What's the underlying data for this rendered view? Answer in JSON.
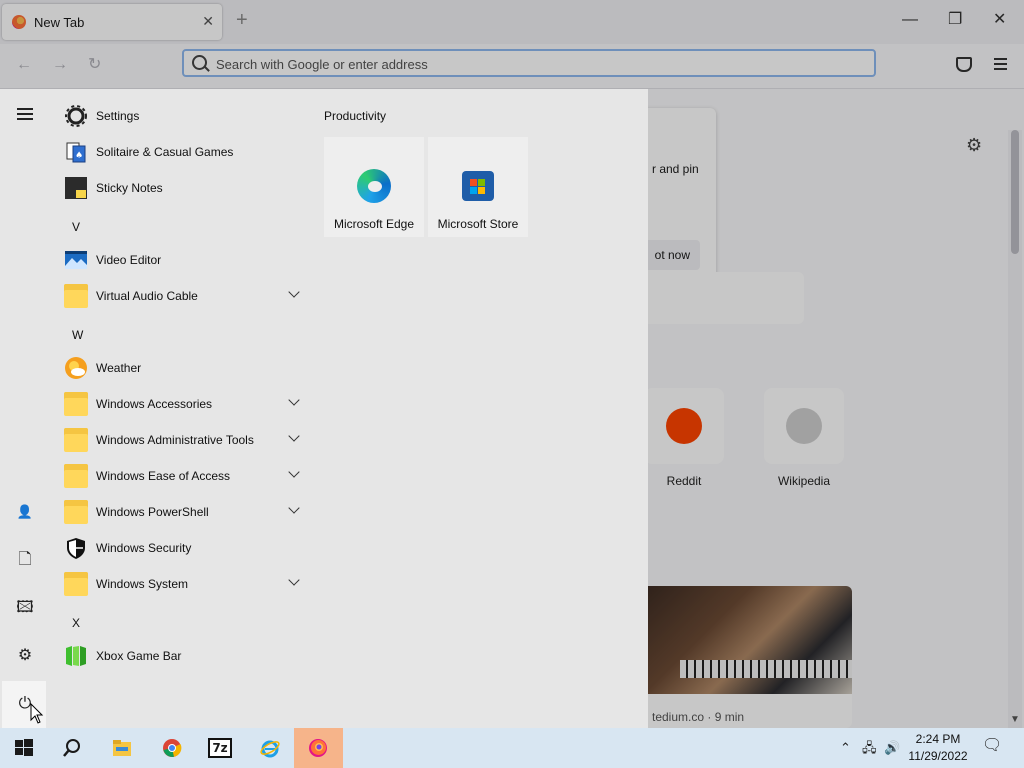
{
  "browser": {
    "tab_title": "New Tab",
    "close_tab_glyph": "✕",
    "new_tab_glyph": "+",
    "window_controls": {
      "minimize": "—",
      "restore": "❐",
      "close": "✕"
    },
    "nav": {
      "back": "←",
      "forward": "→",
      "reload": "↻"
    },
    "address_placeholder": "Search with Google or enter address"
  },
  "newtab_page": {
    "promo_text": "r and pin",
    "promo_button": "ot now",
    "gear_glyph": "⚙",
    "top_sites": [
      {
        "label": "Reddit",
        "color": "#ff4500"
      },
      {
        "label": "Wikipedia",
        "color": "#cfcfcf"
      }
    ],
    "story_meta": "tedium.co · 9 min"
  },
  "start_menu": {
    "rail": {
      "menu_glyph": "≡",
      "user_glyph": "👤",
      "documents_glyph": "🗋",
      "pictures_glyph": "🖾",
      "settings_glyph": "⚙",
      "power_glyph": "⏻"
    },
    "apps": [
      {
        "type": "app",
        "label": "Settings",
        "icon": "gear-icon",
        "expandable": false
      },
      {
        "type": "app",
        "label": "Solitaire & Casual Games",
        "icon": "solitaire-icon",
        "expandable": false
      },
      {
        "type": "app",
        "label": "Sticky Notes",
        "icon": "sticky-notes-icon",
        "expandable": false
      },
      {
        "type": "letter",
        "label": "V"
      },
      {
        "type": "app",
        "label": "Video Editor",
        "icon": "video-editor-icon",
        "expandable": false
      },
      {
        "type": "app",
        "label": "Virtual Audio Cable",
        "icon": "folder-icon",
        "expandable": true
      },
      {
        "type": "letter",
        "label": "W"
      },
      {
        "type": "app",
        "label": "Weather",
        "icon": "weather-icon",
        "expandable": false
      },
      {
        "type": "app",
        "label": "Windows Accessories",
        "icon": "folder-icon",
        "expandable": true
      },
      {
        "type": "app",
        "label": "Windows Administrative Tools",
        "icon": "folder-icon",
        "expandable": true
      },
      {
        "type": "app",
        "label": "Windows Ease of Access",
        "icon": "folder-icon",
        "expandable": true
      },
      {
        "type": "app",
        "label": "Windows PowerShell",
        "icon": "folder-icon",
        "expandable": true
      },
      {
        "type": "app",
        "label": "Windows Security",
        "icon": "shield-icon",
        "expandable": false
      },
      {
        "type": "app",
        "label": "Windows System",
        "icon": "folder-icon",
        "expandable": true
      },
      {
        "type": "letter",
        "label": "X"
      },
      {
        "type": "app",
        "label": "Xbox Game Bar",
        "icon": "xbox-game-bar-icon",
        "expandable": false
      }
    ],
    "tile_group": "Productivity",
    "tiles": [
      {
        "label": "Microsoft Edge",
        "icon": "edge-icon"
      },
      {
        "label": "Microsoft Store",
        "icon": "store-icon"
      }
    ]
  },
  "taskbar": {
    "apps": [
      "start-icon",
      "search-icon",
      "file-explorer-icon",
      "chrome-icon",
      "7zip-icon",
      "internet-explorer-icon",
      "firefox-icon"
    ],
    "sevenzip_label": "7z",
    "tray": {
      "chevron": "⌃",
      "network": "🖧",
      "volume": "🔊",
      "notifications": "🗨"
    },
    "time": "2:24 PM",
    "date": "11/29/2022"
  }
}
